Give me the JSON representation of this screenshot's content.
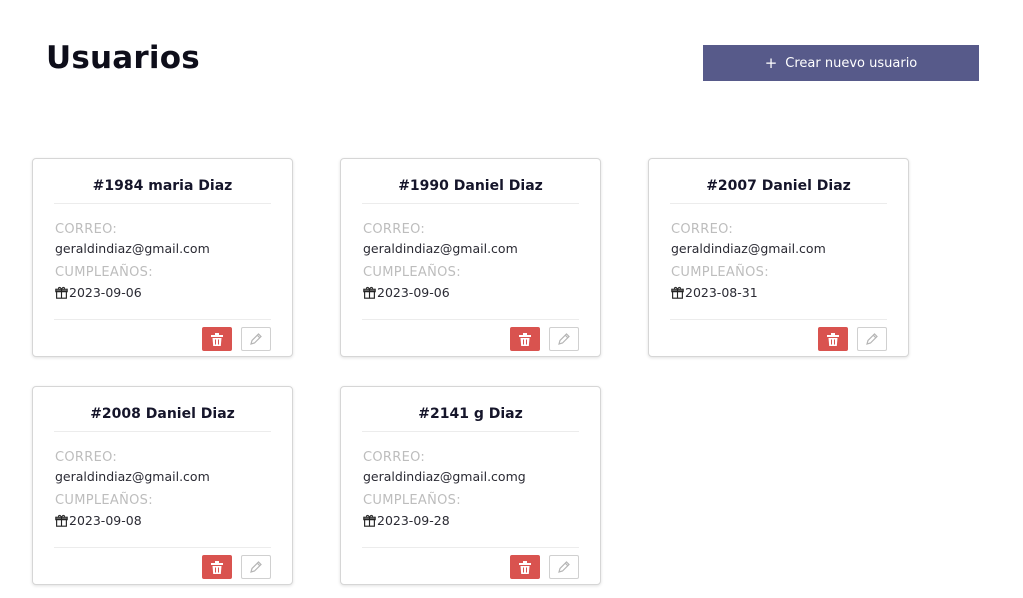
{
  "header": {
    "title": "Usuarios",
    "create_button": {
      "icon": "plus-icon",
      "label": "Crear nuevo usuario"
    }
  },
  "labels": {
    "email": "CORREO:",
    "birthday": "CUMPLEAÑOS:"
  },
  "colors": {
    "accent": "#575a8a",
    "danger": "#d9534f",
    "muted": "#bdbdbd"
  },
  "users": [
    {
      "title": "#1984 maria Diaz",
      "email": "geraldindiaz@gmail.com",
      "birthday": "2023-09-06"
    },
    {
      "title": "#1990 Daniel Diaz",
      "email": "geraldindiaz@gmail.com",
      "birthday": "2023-09-06"
    },
    {
      "title": "#2007 Daniel Diaz",
      "email": "geraldindiaz@gmail.com",
      "birthday": "2023-08-31"
    },
    {
      "title": "#2008 Daniel Diaz",
      "email": "geraldindiaz@gmail.com",
      "birthday": "2023-09-08"
    },
    {
      "title": "#2141 g Diaz",
      "email": "geraldindiaz@gmail.comg",
      "birthday": "2023-09-28"
    }
  ],
  "card_icons": {
    "birthday": "gift-icon",
    "delete": "trash-icon",
    "edit": "pencil-icon"
  }
}
